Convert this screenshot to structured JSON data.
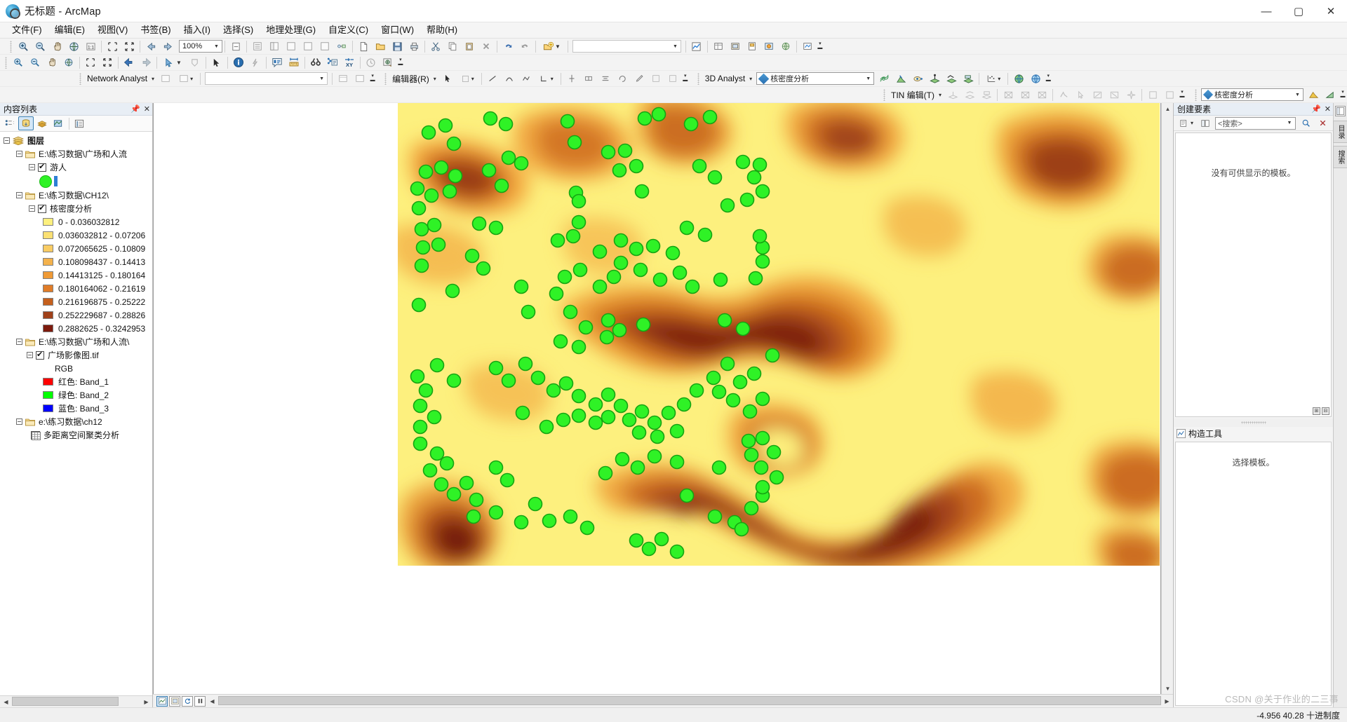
{
  "window": {
    "title": "无标题 - ArcMap",
    "app_icon": "arcmap-globe-icon",
    "minimize": "—",
    "maximize": "▢",
    "close": "✕"
  },
  "menubar": {
    "items": [
      {
        "label": "文件(F)",
        "name": "menu-file"
      },
      {
        "label": "编辑(E)",
        "name": "menu-edit"
      },
      {
        "label": "视图(V)",
        "name": "menu-view"
      },
      {
        "label": "书签(B)",
        "name": "menu-bookmarks"
      },
      {
        "label": "插入(I)",
        "name": "menu-insert"
      },
      {
        "label": "选择(S)",
        "name": "menu-selection"
      },
      {
        "label": "地理处理(G)",
        "name": "menu-geoprocessing"
      },
      {
        "label": "自定义(C)",
        "name": "menu-customize"
      },
      {
        "label": "窗口(W)",
        "name": "menu-window"
      },
      {
        "label": "帮助(H)",
        "name": "menu-help"
      }
    ]
  },
  "toolbar_standard": {
    "zoom_level": "100%",
    "zoom_options": [
      "100%"
    ],
    "buttons": [
      "zoom-in-icon",
      "zoom-out-icon",
      "pan-icon",
      "full-extent-icon",
      "fixed-zoom-icon",
      "zoom-in-fixed-icon",
      "zoom-out-fixed-icon",
      "go-back-extent-icon",
      "go-next-extent-icon"
    ]
  },
  "toolbar_tools": {
    "buttons": [
      "select-features-icon",
      "clear-selection-icon",
      "select-elements-icon",
      "identify-icon",
      "hyperlink-icon",
      "html-popup-icon",
      "measure-icon",
      "find-icon",
      "find-route-icon",
      "go-to-xy-icon",
      "time-slider-icon",
      "create-viewer-icon"
    ]
  },
  "toolbar_network": {
    "label": "Network Analyst",
    "dropdown_value": ""
  },
  "toolbar_editor": {
    "label": "编辑器(R)"
  },
  "toolbar_3d": {
    "label": "3D Analyst",
    "layer_value": "核密度分析"
  },
  "toolbar_tin": {
    "label": "TIN 编辑(T)"
  },
  "toc": {
    "title": "内容列表",
    "pin_icon": "pin-icon",
    "close_icon": "close-icon",
    "view_buttons": [
      {
        "name": "list-by-drawing-order",
        "icon": "drawing-order-icon",
        "active": false
      },
      {
        "name": "list-by-source",
        "icon": "source-icon",
        "active": true
      },
      {
        "name": "list-by-visibility",
        "icon": "visibility-icon",
        "active": false
      },
      {
        "name": "list-by-selection",
        "icon": "selection-icon",
        "active": false
      },
      {
        "name": "options",
        "icon": "options-icon",
        "active": false
      }
    ],
    "root": "图层",
    "groups": [
      {
        "path": "E:\\练习数据\\广场和人流",
        "name": "group-guangchang-renliu",
        "layers": [
          {
            "label": "游人",
            "name": "layer-youren",
            "checked": true,
            "symbol": "green-circle-point"
          }
        ]
      },
      {
        "path": "E:\\练习数据\\CH12\\",
        "name": "group-ch12",
        "layers": [
          {
            "label": "核密度分析",
            "name": "layer-kernel-density",
            "checked": true,
            "classes": [
              {
                "label": "0 - 0.036032812",
                "color": "#fdf07e"
              },
              {
                "label": "0.036032812 - 0.07206",
                "color": "#fbe073"
              },
              {
                "label": "0.072065625 - 0.10809",
                "color": "#f9cc63"
              },
              {
                "label": "0.108098437 - 0.14413",
                "color": "#f4b24c"
              },
              {
                "label": "0.14413125 - 0.180164",
                "color": "#ef9a36"
              },
              {
                "label": "0.180164062 - 0.21619",
                "color": "#e07c28"
              },
              {
                "label": "0.216196875 - 0.25222",
                "color": "#c5601d"
              },
              {
                "label": "0.252229687 - 0.28826",
                "color": "#a0411a"
              },
              {
                "label": "0.2882625 - 0.3242953",
                "color": "#7d1a0d"
              }
            ]
          }
        ]
      },
      {
        "path": "E:\\练习数据\\广场和人流\\",
        "name": "group-guangchang-renliu-2",
        "layers": [
          {
            "label": "广场影像图.tif",
            "name": "layer-guangchang-image-tif",
            "checked": true,
            "rgb_title": "RGB",
            "bands": [
              {
                "label": "红色:   Band_1",
                "color": "#ff0000",
                "name": "band-red"
              },
              {
                "label": "绿色: Band_2",
                "color": "#00ff00",
                "name": "band-green"
              },
              {
                "label": "蓝色:  Band_3",
                "color": "#0000ff",
                "name": "band-blue"
              }
            ]
          }
        ]
      },
      {
        "path": "e:\\练习数据\\ch12",
        "name": "group-ch12-lower",
        "tables": [
          {
            "label": "多距离空间聚类分析",
            "name": "table-multi-distance-clustering"
          }
        ]
      }
    ]
  },
  "right_panel": {
    "title": "创建要素",
    "pin_icon": "pin-icon",
    "close_icon": "close-icon",
    "search_placeholder": "<搜索>",
    "search_value": "",
    "empty_message": "没有可供显示的模板。",
    "section2_title": "构造工具",
    "section2_icon": "construction-tools-icon",
    "section2_message": "选择模板。"
  },
  "vtabs": {
    "items": [
      {
        "label": "目录",
        "name": "vtab-catalog"
      },
      {
        "label": "搜索",
        "name": "vtab-search"
      }
    ]
  },
  "map_view_buttons": [
    {
      "name": "data-view-button",
      "icon": "data-view-icon",
      "selected": true
    },
    {
      "name": "layout-view-button",
      "icon": "layout-view-icon",
      "selected": false
    },
    {
      "name": "refresh-button",
      "icon": "refresh-icon",
      "selected": false
    },
    {
      "name": "pause-drawing-button",
      "icon": "pause-icon",
      "selected": false
    }
  ],
  "statusbar": {
    "coordinates": "-4.956  40.28 十进制度"
  },
  "watermark": "CSDN @关于作业的二三事",
  "map": {
    "name": "kernel-density-map",
    "description": "核密度分析栅格表面叠加游人点图层",
    "background": "#fdf07e",
    "point_color": "#2ff226",
    "point_stroke": "#16a312",
    "density_ramp": [
      "#fdf07e",
      "#fbe073",
      "#f9cc63",
      "#f4b24c",
      "#ef9a36",
      "#e07c28",
      "#c5601d",
      "#a0411a",
      "#7d1a0d"
    ]
  }
}
